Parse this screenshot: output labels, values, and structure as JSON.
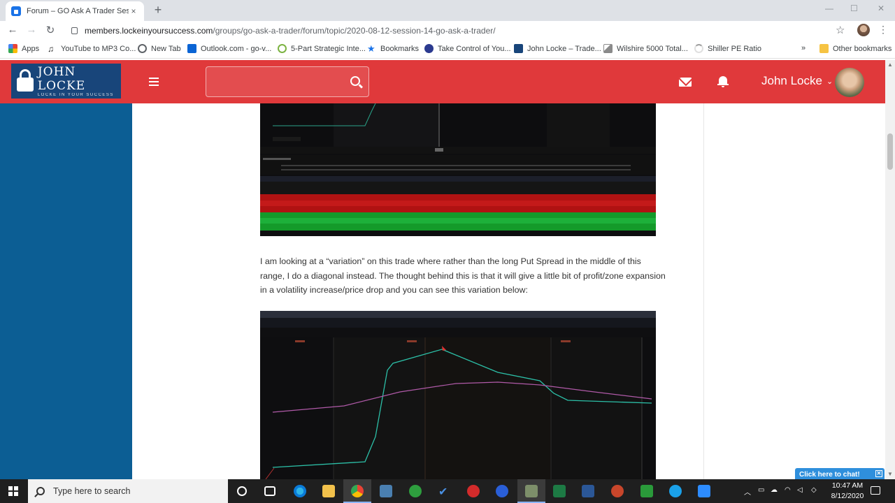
{
  "browser": {
    "tab_title": "Forum – GO Ask A Trader Session",
    "tab_close": "×",
    "new_tab": "+",
    "url_host": "members.lockeinyoursuccess.com",
    "url_path": "/groups/go-ask-a-trader/forum/topic/2020-08-12-session-14-go-ask-a-trader/",
    "bookmarks": [
      {
        "label": "Apps",
        "icon": "apps-grid-icon",
        "color": "#4285f4"
      },
      {
        "label": "YouTube to MP3 Co...",
        "icon": "music-note-icon",
        "color": "#222222"
      },
      {
        "label": "New Tab",
        "icon": "globe-icon",
        "color": "#5f6368"
      },
      {
        "label": "Outlook.com - go-v...",
        "icon": "outlook-icon",
        "color": "#0a64d4"
      },
      {
        "label": "5-Part Strategic Inte...",
        "icon": "spiral-icon",
        "color": "#7cb342"
      },
      {
        "label": "Bookmarks",
        "icon": "star-icon",
        "color": "#1a73e8"
      },
      {
        "label": "Take Control of You...",
        "icon": "circle-logo-icon",
        "color": "#2b3a8f"
      },
      {
        "label": "John Locke – Trade...",
        "icon": "lock-logo-icon",
        "color": "#18457a"
      },
      {
        "label": "Wilshire 5000 Total...",
        "icon": "chart-icon",
        "color": "#8a8a8a"
      },
      {
        "label": "Shiller PE Ratio",
        "icon": "loading-icon",
        "color": "#9e9e9e"
      }
    ],
    "more_bookmarks": "»",
    "other_bookmarks": "Other bookmarks"
  },
  "site": {
    "logo_name": "JOHN LOCKE",
    "logo_tagline": "LOCKE IN YOUR SUCCESS",
    "search_placeholder": "",
    "user_name": "John Locke",
    "user_chevron": "⌄"
  },
  "post": {
    "paragraph": "I am looking at a “variation” on this trade where rather than the long Put Spread in the middle of this range, I do a diagonal instead.  The thought behind this is that it will give a little bit of profit/zone expansion in a volatility increase/price drop and you can see this variation below:"
  },
  "chat": {
    "label": "Click here to chat!"
  },
  "taskbar": {
    "search_placeholder": "Type here to search",
    "time": "10:47 AM",
    "date": "8/12/2020"
  },
  "colors": {
    "site_red": "#e0393b",
    "sidebar_blue": "#0c5e94",
    "logo_navy": "#18457a",
    "chat_blue": "#2f8fdc"
  }
}
